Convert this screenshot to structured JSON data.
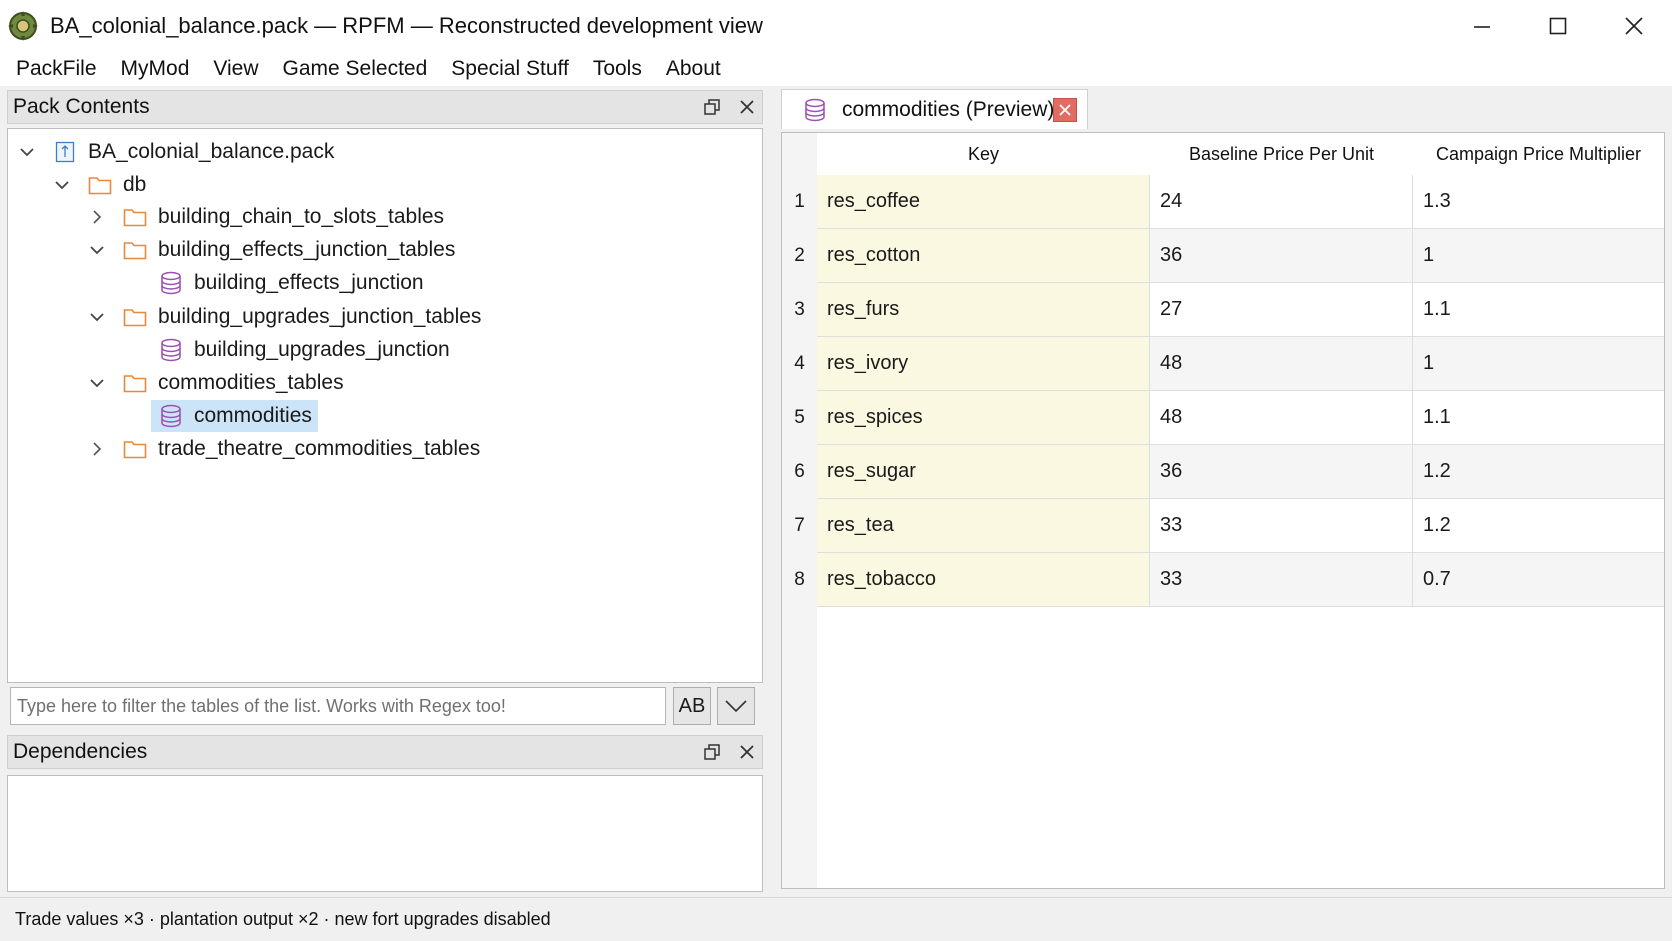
{
  "window": {
    "title": "BA_colonial_balance.pack — RPFM — Reconstructed development view"
  },
  "menu": [
    "PackFile",
    "MyMod",
    "View",
    "Game Selected",
    "Special Stuff",
    "Tools",
    "About"
  ],
  "pack_contents": {
    "title": "Pack Contents",
    "tree": [
      {
        "label": "BA_colonial_balance.pack",
        "kind": "pack",
        "arrow": "down"
      },
      {
        "label": "db",
        "kind": "folder",
        "arrow": "down"
      },
      {
        "label": "building_chain_to_slots_tables",
        "kind": "folder",
        "arrow": "right"
      },
      {
        "label": "building_effects_junction_tables",
        "kind": "folder",
        "arrow": "down"
      },
      {
        "label": "building_effects_junction",
        "kind": "table",
        "arrow": ""
      },
      {
        "label": "building_upgrades_junction_tables",
        "kind": "folder",
        "arrow": "down"
      },
      {
        "label": "building_upgrades_junction",
        "kind": "table",
        "arrow": ""
      },
      {
        "label": "commodities_tables",
        "kind": "folder",
        "arrow": "down"
      },
      {
        "label": "commodities",
        "kind": "table",
        "arrow": "",
        "selected": true
      },
      {
        "label": "trade_theatre_commodities_tables",
        "kind": "folder",
        "arrow": "right"
      }
    ],
    "filter_placeholder": "Type here to filter the tables of the list. Works with Regex too!",
    "case_button": "AB"
  },
  "dependencies": {
    "title": "Dependencies"
  },
  "editor": {
    "tab_label": "commodities (Preview)",
    "columns": [
      "Key",
      "Baseline Price Per Unit",
      "Campaign Price Multiplier"
    ],
    "rows": [
      {
        "n": "1",
        "key": "res_coffee",
        "base": "24",
        "mult": "1.3"
      },
      {
        "n": "2",
        "key": "res_cotton",
        "base": "36",
        "mult": "1"
      },
      {
        "n": "3",
        "key": "res_furs",
        "base": "27",
        "mult": "1.1"
      },
      {
        "n": "4",
        "key": "res_ivory",
        "base": "48",
        "mult": "1"
      },
      {
        "n": "5",
        "key": "res_spices",
        "base": "48",
        "mult": "1.1"
      },
      {
        "n": "6",
        "key": "res_sugar",
        "base": "36",
        "mult": "1.2"
      },
      {
        "n": "7",
        "key": "res_tea",
        "base": "33",
        "mult": "1.2"
      },
      {
        "n": "8",
        "key": "res_tobacco",
        "base": "33",
        "mult": "0.7"
      }
    ]
  },
  "status": "Trade values ×3 · plantation output ×2 · new fort upgrades disabled",
  "colors": {
    "folder": "#e8883a",
    "table_icon": "#9b4fb0",
    "selected": "#cce4f7",
    "key_column": "#fbf8e2",
    "tab_close": "#e06c63"
  }
}
